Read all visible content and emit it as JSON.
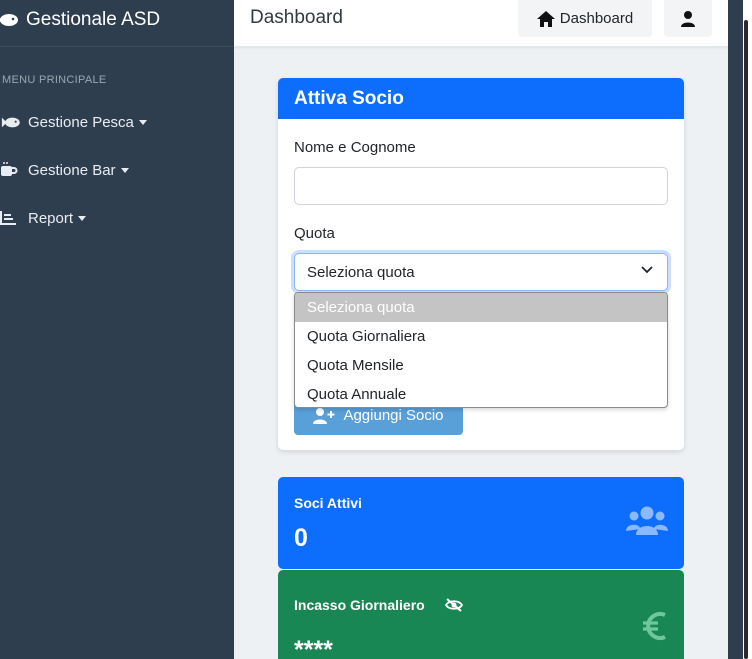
{
  "sidebar": {
    "brand": "Gestionale ASD",
    "menu_title": "MENU PRINCIPALE",
    "items": [
      {
        "label": "Gestione Pesca",
        "icon": "fish-icon"
      },
      {
        "label": "Gestione Bar",
        "icon": "coffee-icon"
      },
      {
        "label": "Report",
        "icon": "chart-icon"
      }
    ]
  },
  "header": {
    "title": "Dashboard",
    "dashboard_button": "Dashboard"
  },
  "form": {
    "title": "Attiva Socio",
    "name_label": "Nome e Cognome",
    "name_value": "",
    "quota_label": "Quota",
    "quota_selected": "Seleziona quota",
    "quota_options": [
      "Seleziona quota",
      "Quota Giornaliera",
      "Quota Mensile",
      "Quota Annuale"
    ],
    "submit_label": "Aggiungi Socio"
  },
  "stats": {
    "active_label": "Soci Attivi",
    "active_value": "0",
    "income_label": "Incasso Giornaliero",
    "income_value": "****"
  },
  "colors": {
    "sidebar_bg": "#2f3e4e",
    "primary": "#0d6efd",
    "success": "#198754"
  }
}
